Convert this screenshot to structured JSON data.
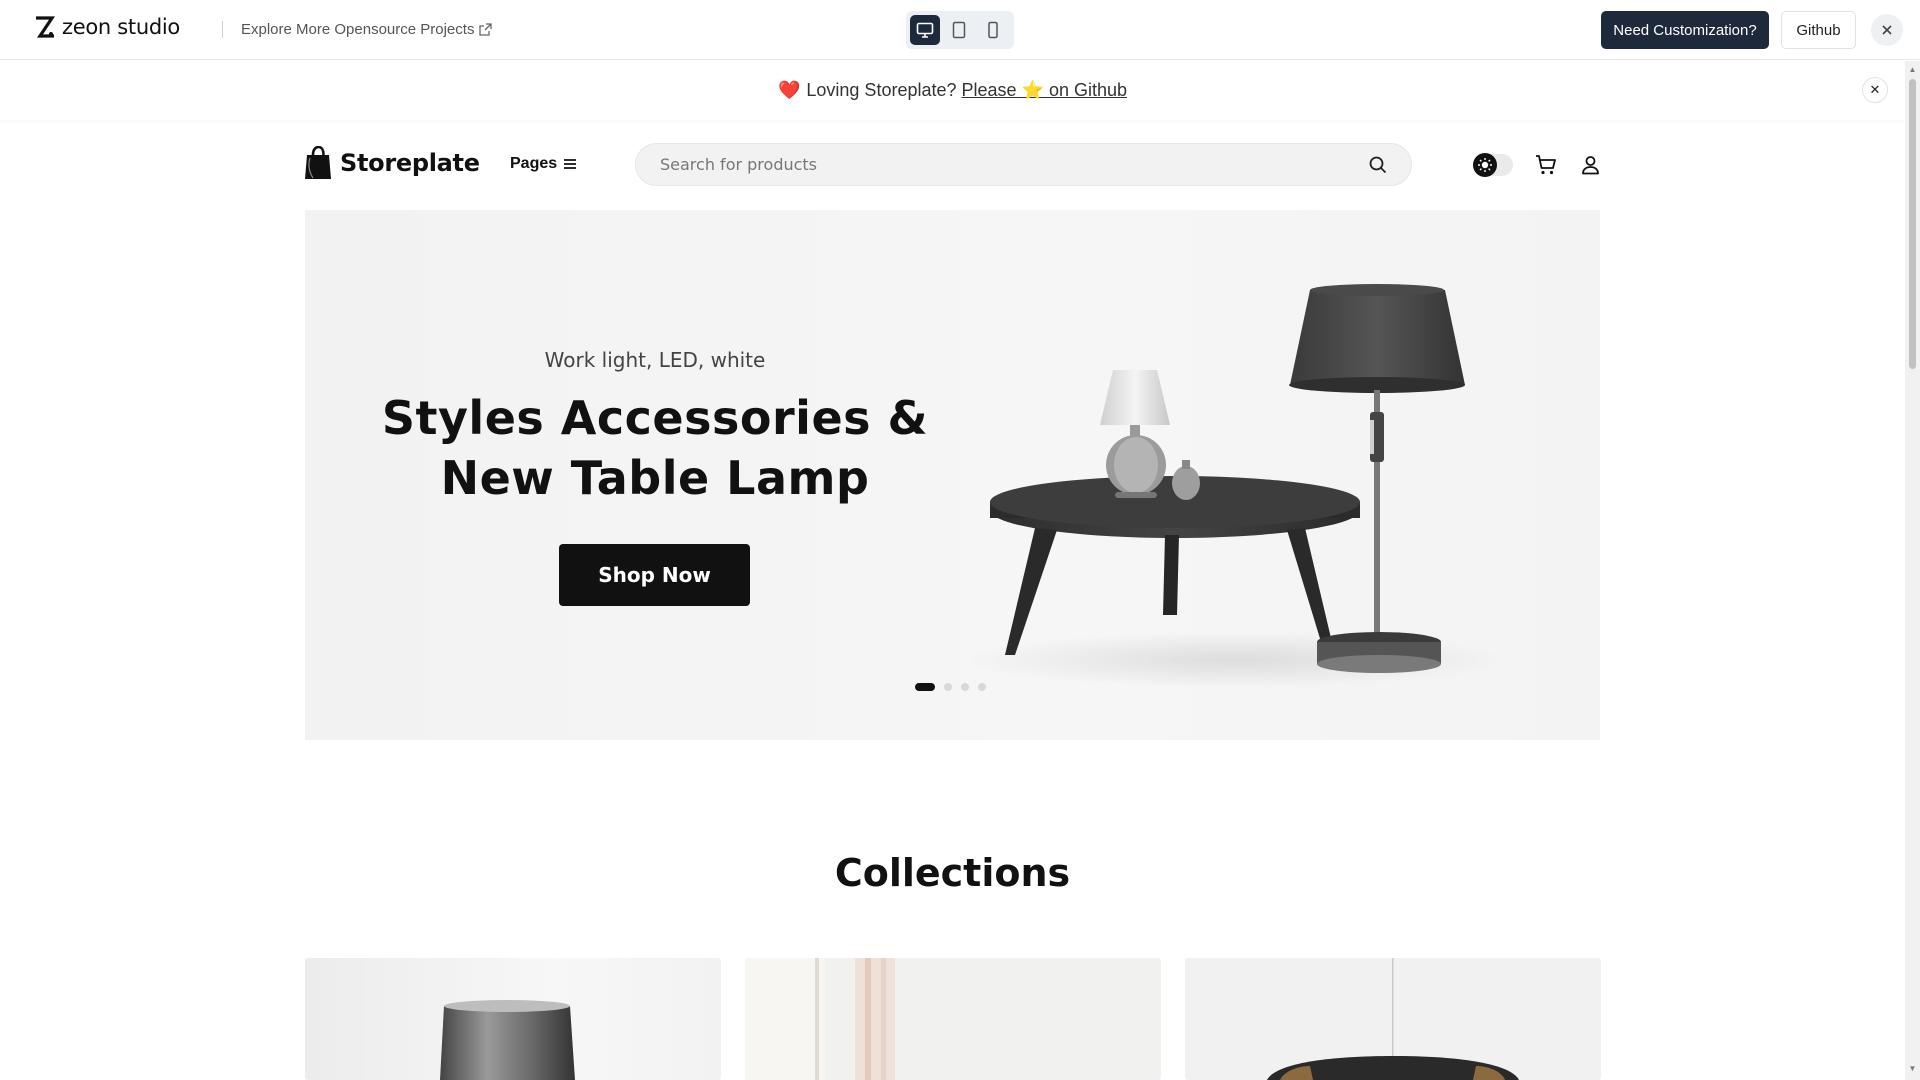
{
  "demo_bar": {
    "brand": "zeon studio",
    "explore_link": "Explore More Opensource Projects",
    "customization_button": "Need Customization?",
    "github_button": "Github"
  },
  "announcement": {
    "text": "Loving Storeplate?",
    "link": "Please ⭐ on Github",
    "heart": "❤️"
  },
  "header": {
    "brand": "Storeplate",
    "pages_menu": "Pages",
    "search_placeholder": "Search for products"
  },
  "hero": {
    "subtitle": "Work light, LED, white",
    "title_line1": "Styles Accessories &",
    "title_line2": "New Table Lamp",
    "cta": "Shop Now",
    "slides": 4,
    "active_slide": 1
  },
  "collections": {
    "title": "Collections"
  },
  "colors": {
    "primary_dark": "#1e293b",
    "accent_black": "#111111",
    "hero_bg": "#f4f4f4"
  }
}
